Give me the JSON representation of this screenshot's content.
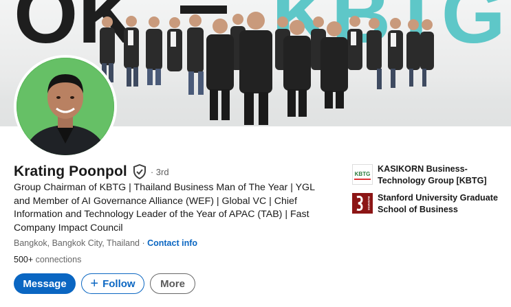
{
  "banner": {
    "big_text_left": "OK",
    "big_text_right": "KBTG",
    "colors": {
      "dark": "#1e1e1e",
      "teal": "#5ec7c8"
    }
  },
  "profile": {
    "name": "Krating Poonpol",
    "degree": "· 3rd",
    "headline": "Group Chairman of KBTG | Thailand Business Man of The Year | YGL and Member of AI Governance Alliance (WEF) | Global VC | Chief Information and Technology Leader of the Year of APAC (TAB) | Fast Company Impact Council",
    "location": "Bangkok, Bangkok City, Thailand",
    "location_separator": " · ",
    "contact_info": "Contact info",
    "connections_count": "500+",
    "connections_label": " connections"
  },
  "actions": {
    "message": "Message",
    "follow": "Follow",
    "more": "More"
  },
  "organizations": [
    {
      "name": "KASIKORN Business-Technology Group [KBTG]",
      "logo_text": "KBTG",
      "icon": "kbtg-logo"
    },
    {
      "name": "Stanford University Graduate School of Business",
      "logo_text": "BUSINESS",
      "icon": "stanford-gsb-logo"
    }
  ],
  "colors": {
    "linkedin_blue": "#0a66c2",
    "text_primary": "#191919",
    "text_secondary": "#666666",
    "photo_background": "#5cb85c",
    "stanford_red": "#8c1515"
  }
}
